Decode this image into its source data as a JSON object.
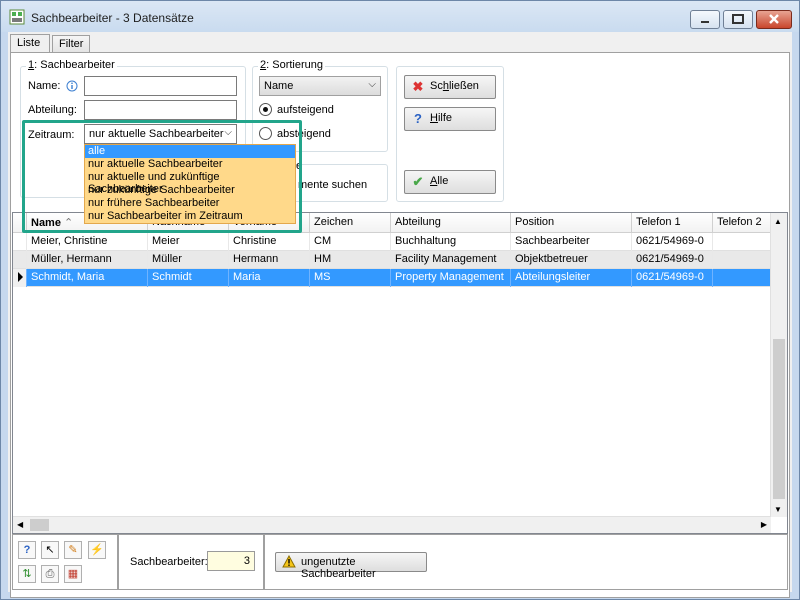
{
  "window": {
    "title": "Sachbearbeiter - 3 Datensätze"
  },
  "tabs": [
    {
      "label": "Liste"
    },
    {
      "label": "Filter"
    }
  ],
  "group1": {
    "title_prefix": "1",
    "title_rest": ": Sachbearbeiter",
    "name_label": "Name:",
    "abteilung_label": "Abteilung:",
    "zeitraum_label": "Zeitraum:",
    "zeitraum_value": "nur aktuelle Sachbearbeiter",
    "name_value": "",
    "abteilung_value": ""
  },
  "dropdown": {
    "options": [
      "alle",
      "nur aktuelle Sachbearbeiter",
      "nur aktuelle und zukünftige Sachbearbeiter",
      "nur zukünftige Sachbearbeiter",
      "nur frühere Sachbearbeiter",
      "nur Sachbearbeiter im Zeitraum"
    ],
    "selected_index": 0
  },
  "group2": {
    "title_prefix": "2",
    "title_rest": ": Sortierung",
    "sort_value": "Name",
    "asc_label": "aufsteigend",
    "desc_label": "absteigend",
    "search_partial_1": "e",
    "search_partial_2": "mente suchen"
  },
  "buttons": {
    "close_prefix": "Sc",
    "close_ul": "h",
    "close_rest": "ließen",
    "help_ul": "H",
    "help_rest": "ilfe",
    "all_ul": "A",
    "all_rest": "lle"
  },
  "grid": {
    "columns": [
      "Name",
      "Nachname",
      "Vorname",
      "Zeichen",
      "Abteilung",
      "Position",
      "Telefon 1",
      "Telefon 2"
    ],
    "rows": [
      [
        "Meier, Christine",
        "Meier",
        "Christine",
        "CM",
        "Buchhaltung",
        "Sachbearbeiter",
        "0621/54969-0",
        ""
      ],
      [
        "Müller, Hermann",
        "Müller",
        "Hermann",
        "HM",
        "Facility Management",
        "Objektbetreuer",
        "0621/54969-0",
        ""
      ],
      [
        "Schmidt, Maria",
        "Schmidt",
        "Maria",
        "MS",
        "Property Management",
        "Abteilungsleiter",
        "0621/54969-0",
        ""
      ]
    ],
    "selected_row": 2
  },
  "footer": {
    "count_label": "Sachbearbeiter:",
    "count_value": "3",
    "unused_button": "ungenutzte Sachbearbeiter"
  },
  "colors": {
    "selection": "#3399ff",
    "highlight_frame": "#22a58b",
    "dropdown_bg": "#ffd98a"
  }
}
